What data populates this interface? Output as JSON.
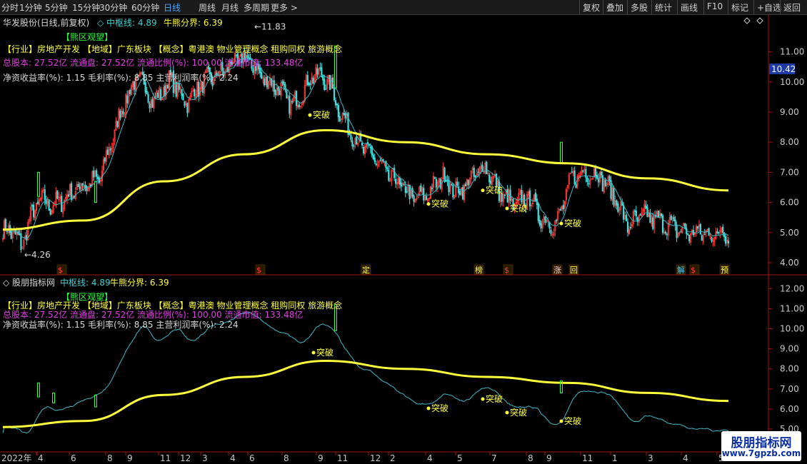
{
  "toolbar": {
    "periods": [
      "分时",
      "1分钟",
      "5分钟",
      "15分钟",
      "30分钟",
      "60分钟",
      "日线",
      "周线",
      "月线",
      "多周期",
      "更多 >"
    ],
    "active_period": "日线",
    "right_buttons": [
      "复权",
      "叠加",
      "多股",
      "统计",
      "画线",
      "F10",
      "标记",
      "+自选",
      "返回"
    ]
  },
  "top_panel": {
    "stock_title": "华发股份(日线,前复权)",
    "indicator_name": "中枢线",
    "indicator_value": "4.89",
    "bull_bear_label": "牛熊分界",
    "bull_bear_value": "6.39",
    "tag": "【熊区观望】",
    "industry_line": "【行业】房地产开发 【地域】广东板块 【概念】粤港澳 物业管理概念 租购同权 旅游概念",
    "share_line": "总股本: 27.52亿 流通盘: 27.52亿 流通比例(%): 100.00 流通市值: 133.48亿",
    "ratio_line": "净资收益率(%): 1.15 毛利率(%): 8.85 主营利润率(%): 2.24",
    "current_price": "10.42",
    "high_label": "11.83",
    "low_label": "4.26",
    "breakout_label": "突破",
    "price_ticks": [
      "11.00",
      "10.00",
      "9.00",
      "8.00",
      "7.00",
      "6.00",
      "5.00",
      "4.00"
    ],
    "markers": [
      "$",
      "$",
      "定",
      "榜",
      "$",
      "涨",
      "回",
      "解",
      "$",
      "预"
    ]
  },
  "bottom_panel": {
    "title": "股朋指标网",
    "indicator_name": "中枢线",
    "indicator_value": "4.89",
    "bull_bear_label": "牛熊分界",
    "bull_bear_value": "6.39",
    "tag": "【熊区观望】",
    "industry_line": "【行业】房地产开发 【地域】广东板块 【概念】粤港澳 物业管理概念 租购同权 旅游概念",
    "share_line": "总股本: 27.52亿 流通盘: 27.52亿 流通比例(%): 100.00 流通市值: 133.48亿",
    "ratio_line": "净资收益率(%): 1.15 毛利率(%): 8.85 主营利润率(%): 2.24",
    "price_ticks": [
      "12.00",
      "11.00",
      "10.00",
      "9.00",
      "8.00",
      "7.00",
      "6.00",
      "5.00"
    ],
    "breakout_label": "突破"
  },
  "time_axis": [
    "2022年",
    "4",
    "6",
    "8",
    "9",
    "11",
    "12",
    "3",
    "4",
    "6",
    "8",
    "9",
    "11",
    "12",
    "2",
    "4",
    "5",
    "7",
    "8",
    "9",
    "11",
    "1",
    "3",
    "4",
    "5"
  ],
  "watermark": {
    "line1": "股朋指标网",
    "line2": "www.7gpzb.com"
  },
  "colors": {
    "up": "#ff3a3a",
    "down": "#3fe0e0",
    "bull_bear_line": "#ffff3c",
    "center_line": "#3fb8c8",
    "grid": "#7a1010"
  },
  "chart_data": {
    "type": "line",
    "title": "华发股份(日线,前复权)",
    "series": [
      {
        "name": "牛熊分界",
        "x": [
          "2022-03",
          "2022-06",
          "2022-09",
          "2022-12",
          "2023-03",
          "2023-06",
          "2023-09",
          "2023-12",
          "2024-03",
          "2024-06"
        ],
        "values": [
          5.1,
          5.4,
          6.7,
          7.6,
          8.4,
          8.0,
          7.6,
          7.3,
          6.8,
          6.4
        ]
      },
      {
        "name": "中枢线",
        "x": [
          "2022-03",
          "2022-06",
          "2022-09",
          "2022-12",
          "2023-03",
          "2023-06",
          "2023-09",
          "2023-12",
          "2024-03",
          "2024-06"
        ],
        "values": [
          5.2,
          6.4,
          9.4,
          10.1,
          9.8,
          6.6,
          6.3,
          6.6,
          5.3,
          4.9
        ]
      }
    ],
    "ylim": [
      3.8,
      12.2
    ],
    "annotations": [
      "11.83",
      "4.26",
      "突破"
    ]
  }
}
